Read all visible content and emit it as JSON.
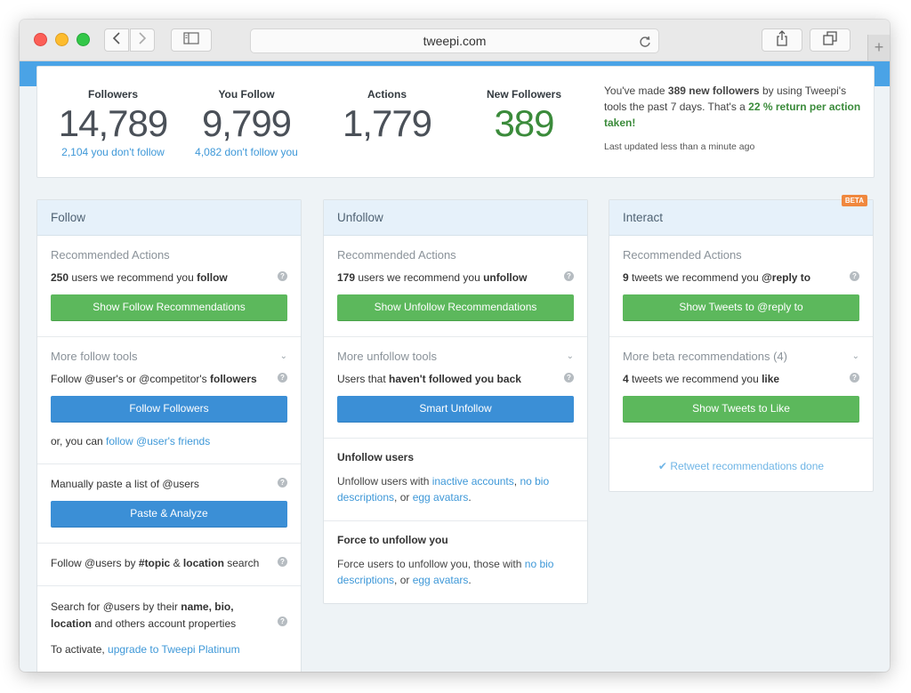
{
  "browser": {
    "url": "tweepi.com",
    "icons": {
      "back": "chevron-left-icon",
      "forward": "chevron-right-icon",
      "sidebar": "sidebar-icon",
      "reload": "reload-icon",
      "share": "share-icon",
      "tabs": "tabs-icon",
      "new_tab": "plus-icon"
    }
  },
  "stats": {
    "followers": {
      "label": "Followers",
      "value": "14,789",
      "sub": "2,104 you don't follow"
    },
    "you_follow": {
      "label": "You Follow",
      "value": "9,799",
      "sub": "4,082 don't follow you"
    },
    "actions": {
      "label": "Actions",
      "value": "1,779"
    },
    "new_followers": {
      "label": "New Followers",
      "value": "389"
    },
    "message": {
      "p1": "You've made ",
      "b1": "389 new followers",
      "p2": " by using Tweepi's tools the past 7 days. That's a ",
      "b2": "22 % return per action taken!"
    },
    "updated": "Last updated less than a minute ago"
  },
  "follow": {
    "title": "Follow",
    "recommended_title": "Recommended Actions",
    "rec_count": "250",
    "rec_text": " users we recommend you ",
    "rec_bold": "follow",
    "rec_button": "Show Follow Recommendations",
    "more_title": "More follow tools",
    "more_text_a": "Follow @user's or @competitor's ",
    "more_text_b": "followers",
    "follow_followers_button": "Follow Followers",
    "or_text": "or, you can ",
    "or_link": "follow @user's friends",
    "paste_text": "Manually paste a list of @users",
    "paste_button": "Paste & Analyze",
    "topic_a": "Follow @users by ",
    "topic_b": "#topic",
    "topic_c": " & ",
    "topic_d": "location",
    "topic_e": " search",
    "search_a": "Search for @users by their ",
    "search_b": "name, bio, location",
    "search_c": " and others account properties",
    "activate_a": "To activate, ",
    "activate_link": "upgrade to Tweepi Platinum"
  },
  "unfollow": {
    "title": "Unfollow",
    "recommended_title": "Recommended Actions",
    "rec_count": "179",
    "rec_text": " users we recommend you ",
    "rec_bold": "unfollow",
    "rec_button": "Show Unfollow Recommendations",
    "more_title": "More unfollow tools",
    "more_text_a": "Users that ",
    "more_text_b": "haven't followed you back",
    "smart_button": "Smart Unfollow",
    "unfollow_users_title": "Unfollow users",
    "uu_a": "Unfollow users with ",
    "uu_link1": "inactive accounts",
    "uu_b": ", ",
    "uu_link2": "no bio descriptions",
    "uu_c": ", or ",
    "uu_link3": "egg avatars",
    "uu_d": ".",
    "force_title": "Force to unfollow you",
    "fu_a": "Force users to unfollow you, those with ",
    "fu_link1": "no bio descriptions",
    "fu_b": ", or ",
    "fu_link2": "egg avatars",
    "fu_c": "."
  },
  "interact": {
    "title": "Interact",
    "beta": "BETA",
    "recommended_title": "Recommended Actions",
    "rec_count": "9",
    "rec_text": " tweets we recommend you ",
    "rec_bold": "@reply to",
    "rec_button": "Show Tweets to @reply to",
    "more_title": "More beta recommendations (4)",
    "more_count": "4",
    "more_text": " tweets we recommend you ",
    "more_bold": "like",
    "like_button": "Show Tweets to Like",
    "done_text": "Retweet recommendations done"
  },
  "colors": {
    "accent_blue": "#4aa3e6",
    "button_green": "#5cb85c",
    "button_blue": "#3b8fd6",
    "highlight_green": "#3b8b3b",
    "link": "#3e98d8",
    "beta": "#f0883e"
  }
}
